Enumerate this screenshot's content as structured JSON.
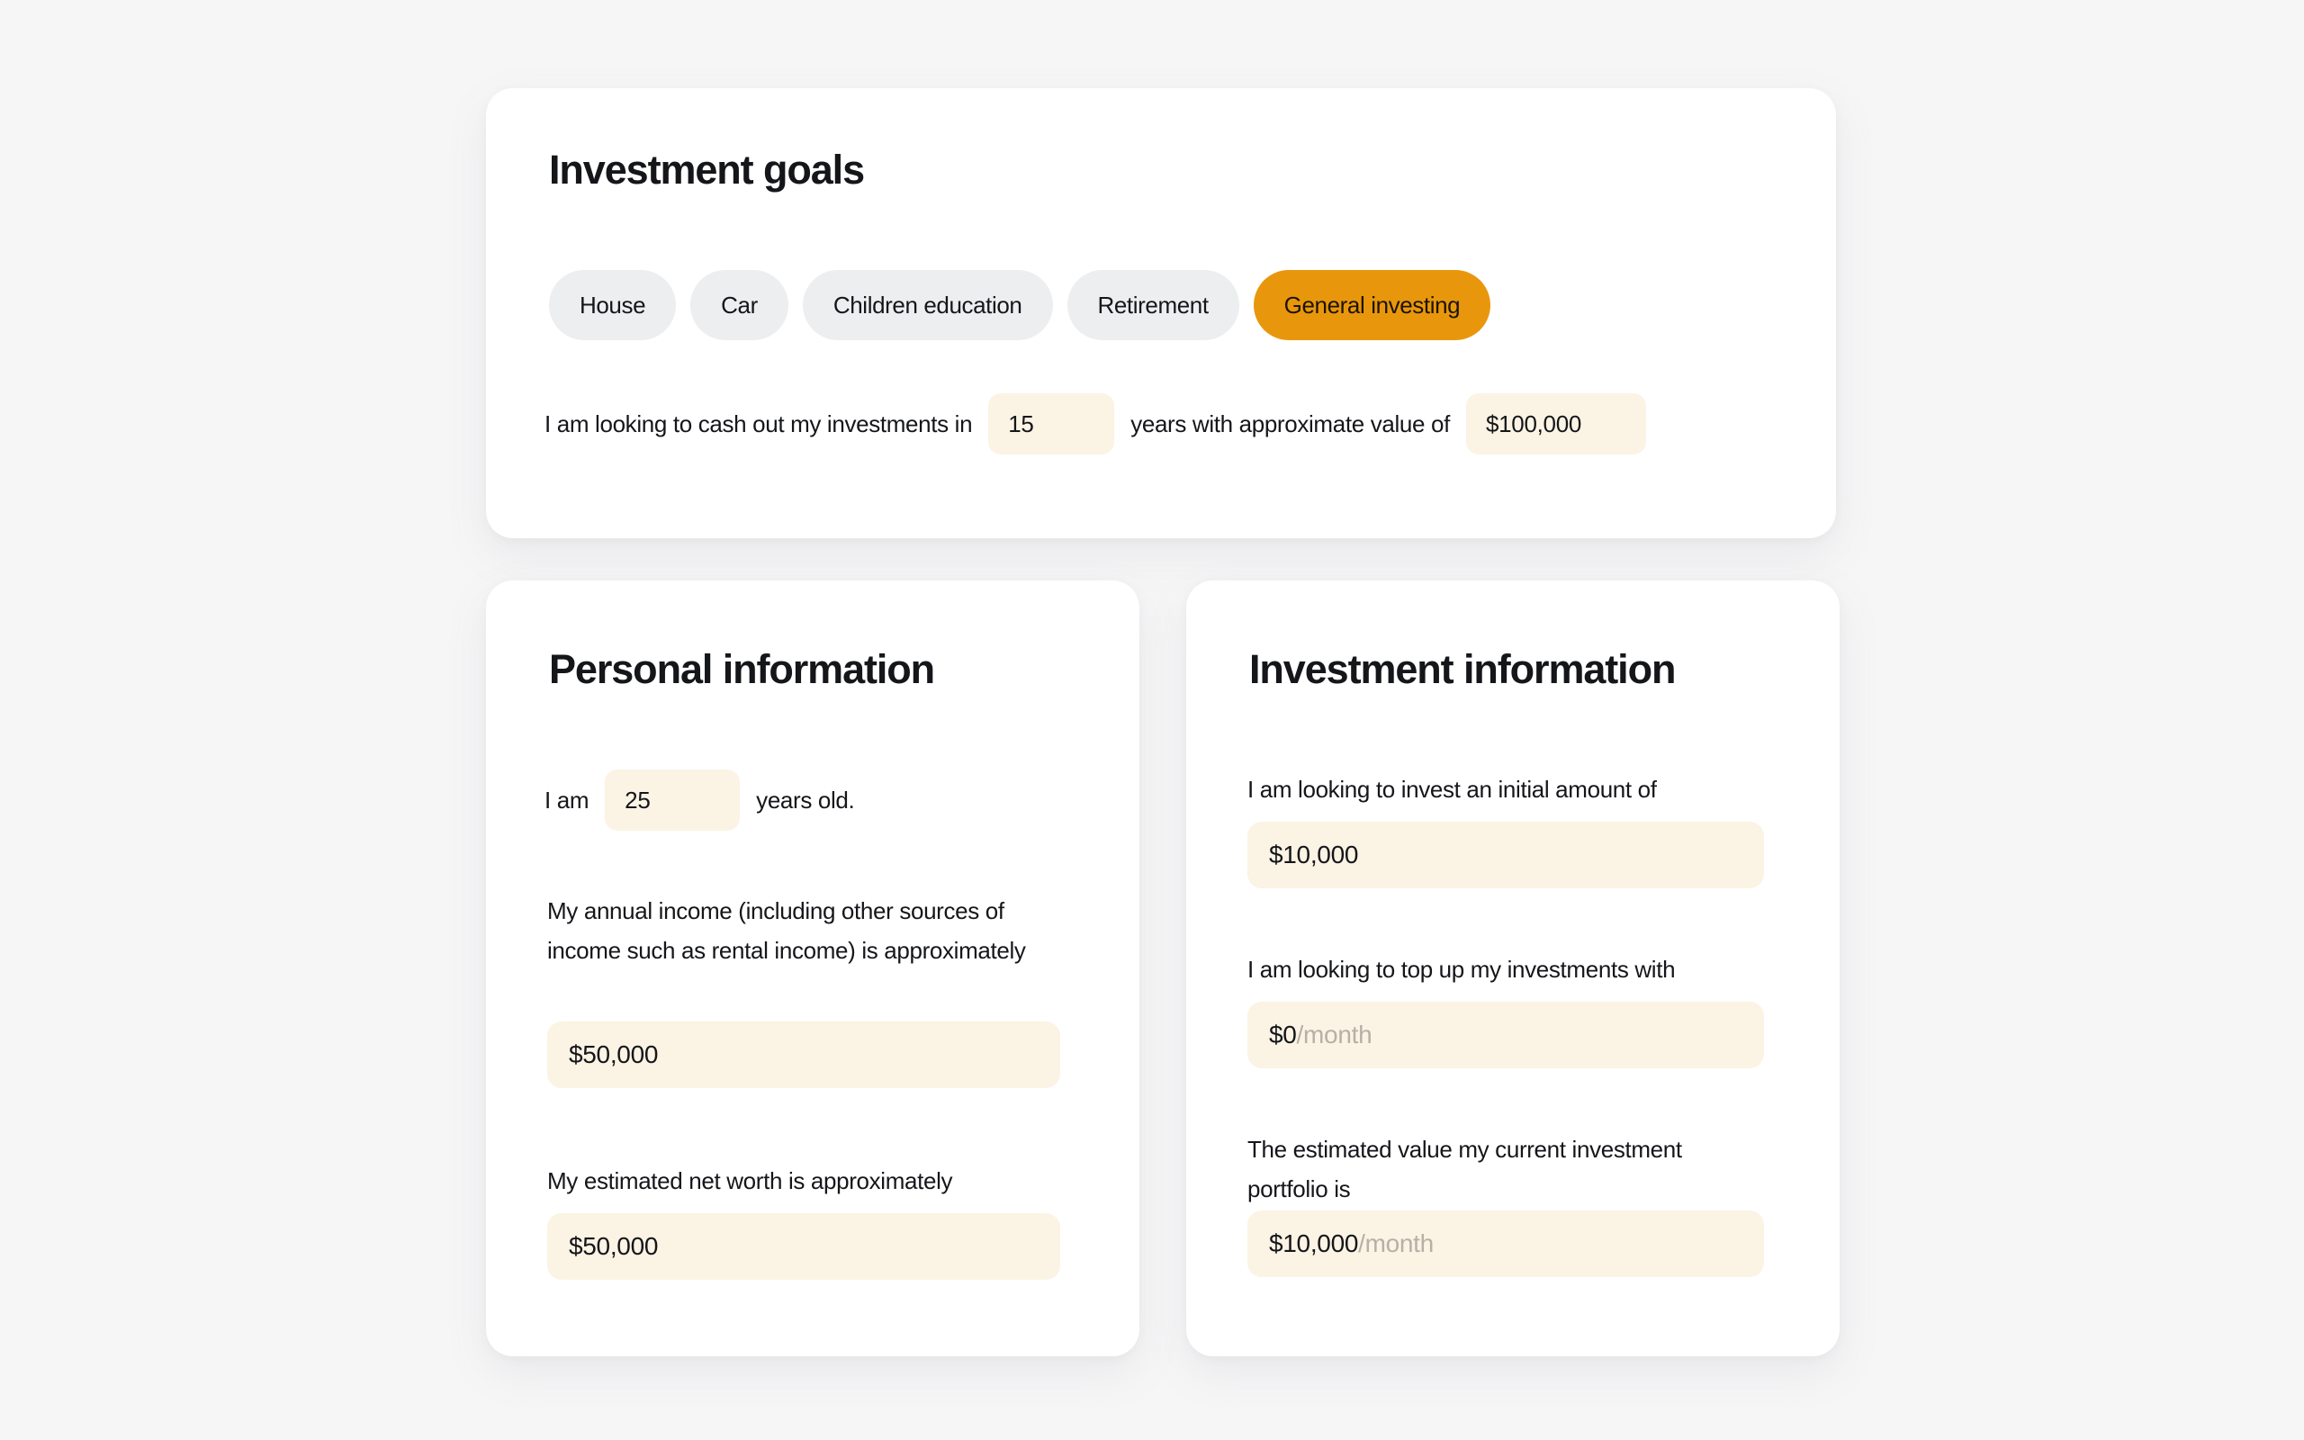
{
  "theme": {
    "page_background": "#f6f6f7",
    "card_background": "#ffffff",
    "accent": "#e8970c",
    "pill_inactive": "#edeeef",
    "field_background": "#fbf3e4",
    "text_primary": "#15161a",
    "text_muted": "#b6b0a6"
  },
  "goals_card": {
    "title": "Investment goals",
    "pills": [
      {
        "label": "House",
        "active": false
      },
      {
        "label": "Car",
        "active": false
      },
      {
        "label": "Children education",
        "active": false
      },
      {
        "label": "Retirement",
        "active": false
      },
      {
        "label": "General investing",
        "active": true
      }
    ],
    "sentence": {
      "lead": "I am looking to cash out my investments in",
      "years_value": "15",
      "middle": "years with approximate value of",
      "target_value": "$100,000"
    }
  },
  "personal_card": {
    "title": "Personal information",
    "age_row": {
      "lead": "I am",
      "age_value": "25",
      "trail": "years old."
    },
    "income": {
      "label": "My annual income (including other sources of income such as rental income)\nis approximately",
      "value": "$50,000"
    },
    "net_worth": {
      "label": "My estimated net worth is approximately",
      "value": "$50,000"
    }
  },
  "investment_card": {
    "title": "Investment information",
    "initial_amount": {
      "label": "I am looking to invest an initial amount of",
      "value": "$10,000"
    },
    "top_up": {
      "label": "I am looking to top up my investments with",
      "value": "$0",
      "suffix": "/month"
    },
    "current_portfolio": {
      "label": "The estimated value my current investment portfolio is",
      "value": "$10,000",
      "suffix": "/month"
    }
  }
}
